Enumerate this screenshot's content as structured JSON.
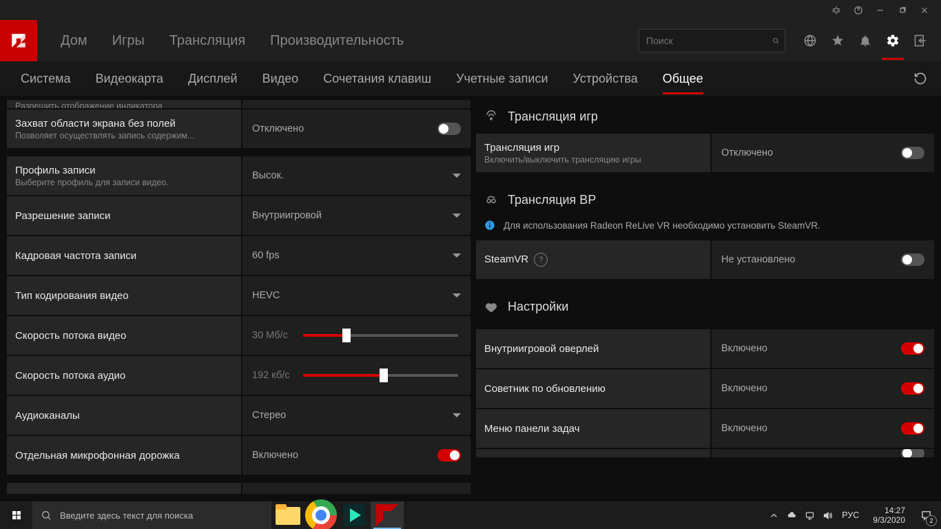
{
  "titlebar_buttons": [
    "bug",
    "help",
    "minimize",
    "restore",
    "close"
  ],
  "header": {
    "nav": [
      "Дом",
      "Игры",
      "Трансляция",
      "Производительность"
    ],
    "search_placeholder": "Поиск"
  },
  "subnav": {
    "items": [
      "Система",
      "Видеокарта",
      "Дисплей",
      "Видео",
      "Сочетания клавиш",
      "Учетные записи",
      "Устройства",
      "Общее"
    ],
    "active_index": 7
  },
  "left": {
    "truncated_row": {
      "title_partial": "",
      "sub_partial": "Разрешить отображение индикатора"
    },
    "borderless": {
      "title": "Захват области экрана без полей",
      "sub": "Позволяет осуществлять запись содержим...",
      "value": "Отключено",
      "state": false
    },
    "profile": {
      "title": "Профиль записи",
      "sub": "Выберите профиль для записи видео.",
      "value": "Высок."
    },
    "resolution": {
      "title": "Разрешение записи",
      "value": "Внутриигровой"
    },
    "fps": {
      "title": "Кадровая частота записи",
      "value": "60 fps"
    },
    "encoding": {
      "title": "Тип кодирования видео",
      "value": "HEVC"
    },
    "video_bitrate": {
      "title": "Скорость потока видео",
      "value": "30 Мб/с",
      "percent": 28
    },
    "audio_bitrate": {
      "title": "Скорость потока аудио",
      "value": "192 кб/с",
      "percent": 52
    },
    "channels": {
      "title": "Аудиоканалы",
      "value": "Стерео"
    },
    "mic_track": {
      "title": "Отдельная микрофонная дорожка",
      "value": "Включено",
      "state": true
    }
  },
  "right": {
    "stream_hdr": "Трансляция игр",
    "stream_row": {
      "title": "Трансляция игр",
      "sub": "Включить/выключить трансляцию игры",
      "value": "Отключено",
      "state": false
    },
    "vr_hdr": "Трансляция ВР",
    "vr_info": "Для использования Radeon ReLive VR необходимо установить SteamVR.",
    "steamvr": {
      "title": "SteamVR",
      "value": "Не установлено",
      "state": false
    },
    "settings_hdr": "Настройки",
    "overlay": {
      "title": "Внутриигровой оверлей",
      "value": "Включено",
      "state": true
    },
    "advisor": {
      "title": "Советник по обновлению",
      "value": "Включено",
      "state": true
    },
    "taskmenu": {
      "title": "Меню панели задач",
      "value": "Включено",
      "state": true
    }
  },
  "taskbar": {
    "search_placeholder": "Введите здесь текст для поиска",
    "lang": "РУС",
    "time": "14:27",
    "date": "9/3/2020",
    "notif_count": "2"
  }
}
